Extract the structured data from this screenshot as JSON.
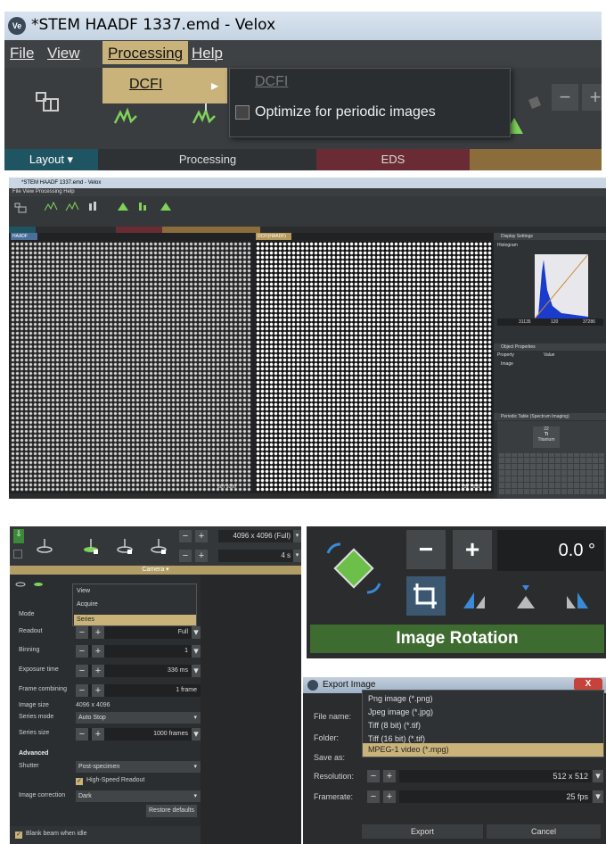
{
  "panel1": {
    "window_title": "*STEM HAADF 1337.emd - Velox",
    "logo_text": "Ve",
    "menu": [
      "File",
      "View",
      "Processing",
      "Help"
    ],
    "dropdown_item": "DCFI",
    "submenu": {
      "dcfi": "DCFI",
      "optimize": "Optimize for periodic images"
    },
    "ribbon_labels": {
      "layout": "Layout ▾",
      "processing": "Processing",
      "eds": "EDS"
    },
    "zoom_minus": "−",
    "zoom_plus": "+"
  },
  "panel2": {
    "window_title": "*STEM HAADF 1337.emd - Velox",
    "menu": "File  View  Processing  Help",
    "tab_left": "HAADF",
    "tab_right": "DCFI(HAADF)",
    "display_settings": "Display Settings",
    "histogram": "Histogram",
    "hist_range": [
      "31135",
      "120",
      "37286"
    ],
    "object_properties": "Object Properties",
    "property_col": "Property",
    "value_col": "Value",
    "image_row": "Image",
    "periodic_table": "Periodic Table (Spectrum Imaging)",
    "element_number": "22",
    "element_symbol": "Ti",
    "element_name": "Titanium",
    "frame_left": "80 / 1000",
    "frame_right": "252 / 899"
  },
  "panel3": {
    "resolution": "4096 x 4096 (Full)",
    "time": "4 s",
    "camera": "Camera ▾",
    "popup": [
      "View",
      "Acquire",
      "Series"
    ],
    "rows": [
      {
        "label": "Mode",
        "value": ""
      },
      {
        "label": "Readout",
        "value": "Full"
      },
      {
        "label": "Binning",
        "value": "1"
      },
      {
        "label": "Exposure time",
        "value": "336 ms"
      },
      {
        "label": "Frame combining",
        "value": "1 frame"
      },
      {
        "label": "Image size",
        "value": "4096 x 4096"
      },
      {
        "label": "Series mode",
        "value": "Auto Stop"
      },
      {
        "label": "Series size",
        "value": "1000 frames"
      }
    ],
    "advanced": "Advanced",
    "shutter_label": "Shutter",
    "shutter_value": "Post-specimen",
    "high_speed": "High-Speed Readout",
    "image_correction_label": "Image correction",
    "image_correction_value": "Dark",
    "restore": "Restore defaults",
    "blank_beam": "Blank beam when idle"
  },
  "panel4": {
    "minus": "−",
    "plus": "+",
    "angle": "0.0 °",
    "label": "Image Rotation"
  },
  "panel5": {
    "title": "Export Image",
    "close": "X",
    "labels": [
      "File name:",
      "Folder:",
      "Save as:",
      "Resolution:",
      "Framerate:"
    ],
    "formats": [
      "Png image (*.png)",
      "Jpeg image (*.jpg)",
      "Tiff (8 bit) (*.tif)",
      "Tiff (16 bit) (*.tif)",
      "MPEG-1 video (*.mpg)"
    ],
    "resolution": "512 x 512",
    "framerate": "25 fps",
    "export": "Export",
    "cancel": "Cancel"
  }
}
